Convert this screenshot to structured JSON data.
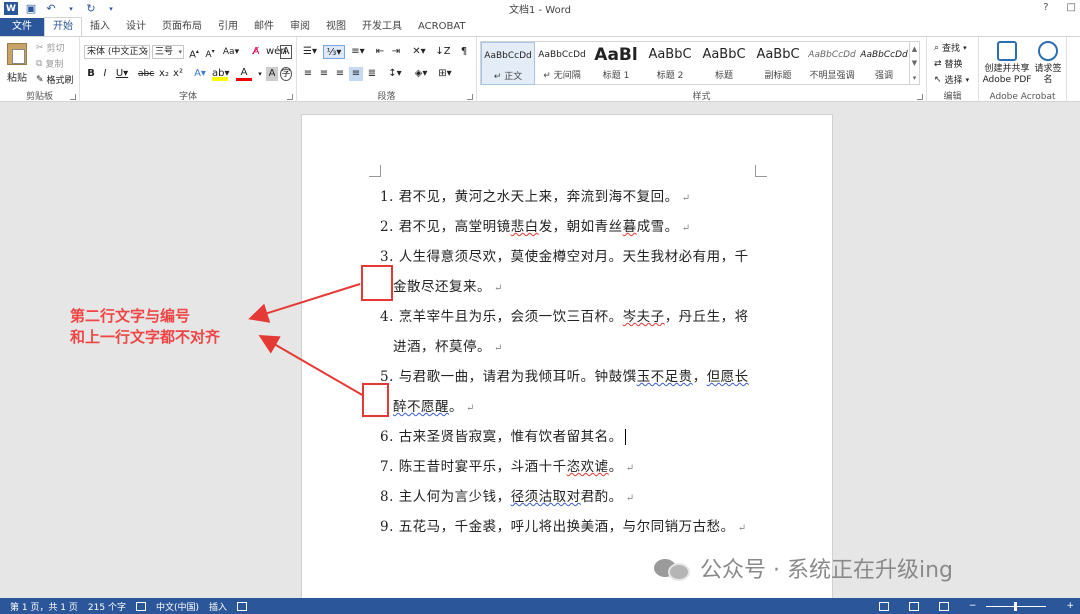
{
  "window": {
    "title": "文档1 - Word",
    "help": "?",
    "restore": "□"
  },
  "tabs": [
    "文件",
    "开始",
    "插入",
    "设计",
    "页面布局",
    "引用",
    "邮件",
    "审阅",
    "视图",
    "开发工具",
    "ACROBAT"
  ],
  "active_tab": "开始",
  "clipboard": {
    "paste": "粘贴",
    "cut": "剪切",
    "copy": "复制",
    "format_painter": "格式刷",
    "label": "剪贴板"
  },
  "font": {
    "name": "宋体 (中文正文",
    "size": "三号",
    "label": "字体"
  },
  "paragraph": {
    "label": "段落"
  },
  "styles": {
    "label": "样式",
    "items": [
      {
        "sample": "AaBbCcDd",
        "name": "↵ 正文"
      },
      {
        "sample": "AaBbCcDd",
        "name": "↵ 无间隔"
      },
      {
        "sample": "AaBl",
        "name": "标题 1"
      },
      {
        "sample": "AaBbC",
        "name": "标题 2"
      },
      {
        "sample": "AaBbC",
        "name": "标题"
      },
      {
        "sample": "AaBbC",
        "name": "副标题"
      },
      {
        "sample": "AaBbCcDd",
        "name": "不明显强调"
      },
      {
        "sample": "AaBbCcDd",
        "name": "强调"
      }
    ]
  },
  "editing": {
    "find": "查找",
    "replace": "替换",
    "select": "选择",
    "label": "编辑"
  },
  "acrobat": {
    "create_pdf": "创建并共享 Adobe PDF",
    "request_sign": "请求签名",
    "label": "Adobe Acrobat"
  },
  "document": {
    "lines": [
      {
        "num": "1.",
        "text": "君不见，黄河之水天上来，奔流到海不复回。"
      },
      {
        "num": "2.",
        "text_before": "君不见，高堂明镜",
        "wavy": "悲白",
        "text_after": "发，朝如青丝",
        "wavy2": "暮",
        "text_end": "成雪。"
      },
      {
        "num": "3.",
        "text": "人生得意须尽欢，莫使金樽空对月。天生我材必有用，千"
      },
      {
        "cont": true,
        "text": "金散尽还复来。"
      },
      {
        "num": "4.",
        "text_before": "烹羊宰牛且为乐，会须一饮三百杯。",
        "wavy": "岑夫子",
        "text_after": "，丹丘生，将"
      },
      {
        "cont": true,
        "text": "进酒，杯莫停。"
      },
      {
        "num": "5.",
        "text_before": "与君歌一曲，请君为我倾耳听。钟鼓馔",
        "wavy_b": "玉不足贵",
        "text_after": "，",
        "wavy_b2": "但愿长"
      },
      {
        "cont": true,
        "wavy_b": "醉不愿醒",
        "text": "。"
      },
      {
        "num": "6.",
        "text": "古来圣贤皆寂寞，惟有饮者留其名。"
      },
      {
        "num": "7.",
        "text_before": "陈王昔时宴平乐，斗酒十千",
        "wavy": "恣欢谑",
        "text_after": "。"
      },
      {
        "num": "8.",
        "text_before": "主人何为言少钱，",
        "wavy_b": "径须沽取对",
        "text_after": "君酌。"
      },
      {
        "num": "9.",
        "text": "五花马，千金裘，呼儿将出换美酒，与尔同销万古愁。"
      }
    ]
  },
  "annotation": {
    "line1": "第二行文字与编号",
    "line2": "和上一行文字都不对齐"
  },
  "watermark": "公众号 · 系统正在升级ing",
  "status": {
    "page": "第 1 页，共 1 页",
    "words": "215 个字",
    "lang": "中文(中国)",
    "mode": "插入"
  },
  "colors": {
    "accent": "#2b579a",
    "annotation_red": "#e53935"
  }
}
